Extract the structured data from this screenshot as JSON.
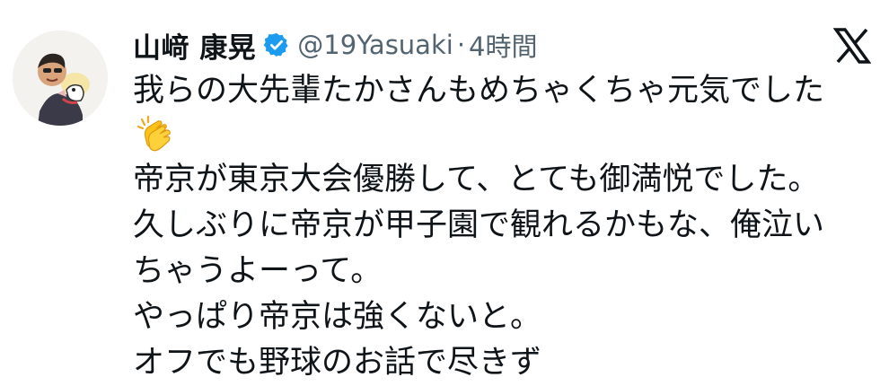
{
  "post": {
    "author": {
      "display_name": "山﨑 康晃",
      "handle": "@19Yasuaki",
      "verified": true,
      "avatar_icon": "avatar-illustration"
    },
    "separator": "·",
    "time": "4時間",
    "platform_icon": "x-logo-icon",
    "text_lines": [
      "我らの大先輩たかさんもめちゃくちゃ元気でした",
      "帝京が東京大会優勝して、とても御満悦でした。",
      "久しぶりに帝京が甲子園で観れるかもな、俺泣い",
      "ちゃうよーって。",
      "やっぱり帝京は強くないと。",
      "オフでも野球のお話で尽きず"
    ],
    "emoji": "clapping-hands-icon"
  },
  "colors": {
    "text": "#0f1419",
    "secondary": "#536471",
    "verified_badge": "#1d9bf0"
  }
}
